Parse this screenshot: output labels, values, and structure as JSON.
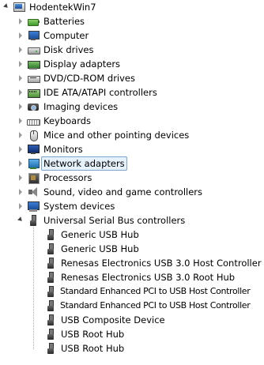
{
  "tree": {
    "root": {
      "label": "HodentekWin7",
      "icon": "computer-icon",
      "expanded": true
    },
    "categories": [
      {
        "label": "Batteries",
        "icon": "battery-icon",
        "expanded": false
      },
      {
        "label": "Computer",
        "icon": "computer-icon",
        "expanded": false
      },
      {
        "label": "Disk drives",
        "icon": "disk-drive-icon",
        "expanded": false
      },
      {
        "label": "Display adapters",
        "icon": "display-adapter-icon",
        "expanded": false
      },
      {
        "label": "DVD/CD-ROM drives",
        "icon": "dvd-drive-icon",
        "expanded": false
      },
      {
        "label": "IDE ATA/ATAPI controllers",
        "icon": "ide-controller-icon",
        "expanded": false
      },
      {
        "label": "Imaging devices",
        "icon": "camera-icon",
        "expanded": false
      },
      {
        "label": "Keyboards",
        "icon": "keyboard-icon",
        "expanded": false
      },
      {
        "label": "Mice and other pointing devices",
        "icon": "mouse-icon",
        "expanded": false
      },
      {
        "label": "Monitors",
        "icon": "monitor-icon",
        "expanded": false
      },
      {
        "label": "Network adapters",
        "icon": "network-adapter-icon",
        "expanded": false,
        "selected": true
      },
      {
        "label": "Processors",
        "icon": "processor-icon",
        "expanded": false
      },
      {
        "label": "Sound, video and game controllers",
        "icon": "speaker-icon",
        "expanded": false
      },
      {
        "label": "System devices",
        "icon": "system-device-icon",
        "expanded": false
      },
      {
        "label": "Universal Serial Bus controllers",
        "icon": "usb-icon",
        "expanded": true
      }
    ],
    "usb_children": [
      {
        "label": "Generic USB Hub",
        "icon": "usb-icon"
      },
      {
        "label": "Generic USB Hub",
        "icon": "usb-icon"
      },
      {
        "label": "Renesas Electronics USB 3.0 Host Controller",
        "icon": "usb-icon"
      },
      {
        "label": "Renesas Electronics USB 3.0 Root Hub",
        "icon": "usb-icon"
      },
      {
        "label": "Standard Enhanced PCI to USB Host Controller",
        "icon": "usb-icon"
      },
      {
        "label": "Standard Enhanced PCI to USB Host Controller",
        "icon": "usb-icon"
      },
      {
        "label": "USB Composite Device",
        "icon": "usb-icon"
      },
      {
        "label": "USB Root Hub",
        "icon": "usb-icon"
      },
      {
        "label": "USB Root Hub",
        "icon": "usb-icon"
      }
    ]
  },
  "colors": {
    "selection_bg": "#e5f1fb",
    "selection_border": "#7da2ce"
  }
}
